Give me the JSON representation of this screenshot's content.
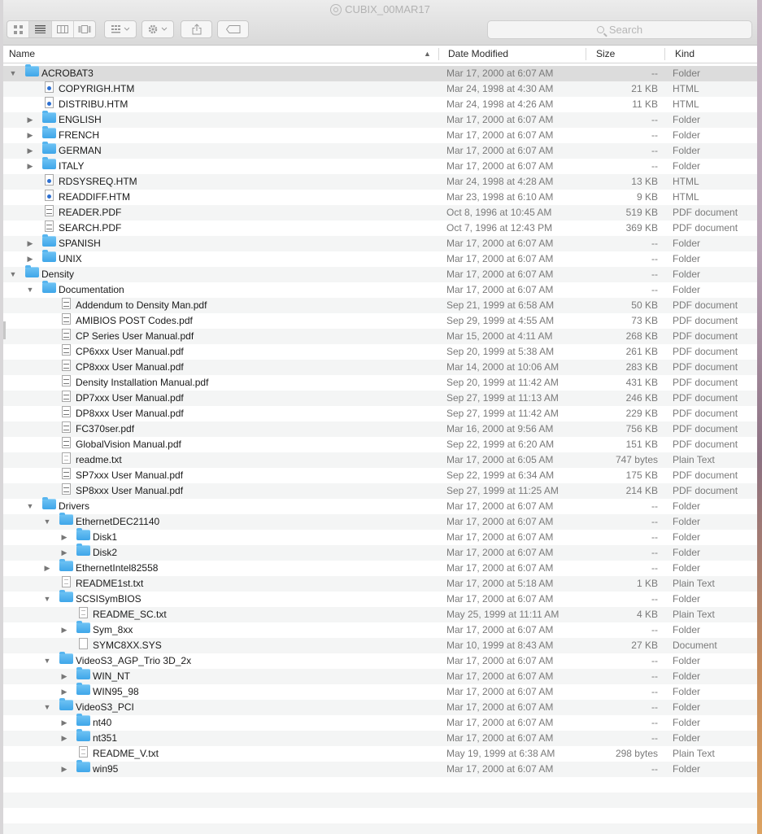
{
  "window": {
    "title": "CUBIX_00MAR17"
  },
  "toolbar": {
    "view_icons": [
      "icon-view-icon",
      "list-view-icon",
      "column-view-icon",
      "cover-flow-icon"
    ],
    "arrange_icon": "arrange-icon",
    "action_icon": "gear-icon",
    "share_icon": "share-icon",
    "tag_icon": "tag-icon"
  },
  "search": {
    "placeholder": "Search"
  },
  "columns": {
    "name": "Name",
    "date": "Date Modified",
    "size": "Size",
    "kind": "Kind"
  },
  "rows": [
    {
      "level": 0,
      "disc": "open",
      "icon": "folder",
      "name": "ACROBAT3",
      "date": "Mar 17, 2000 at 6:07 AM",
      "size": "--",
      "kind": "Folder",
      "selected": true
    },
    {
      "level": 1,
      "disc": "none",
      "icon": "html",
      "name": "COPYRIGH.HTM",
      "date": "Mar 24, 1998 at 4:30 AM",
      "size": "21 KB",
      "kind": "HTML"
    },
    {
      "level": 1,
      "disc": "none",
      "icon": "html",
      "name": "DISTRIBU.HTM",
      "date": "Mar 24, 1998 at 4:26 AM",
      "size": "11 KB",
      "kind": "HTML"
    },
    {
      "level": 1,
      "disc": "closed",
      "icon": "folder",
      "name": "ENGLISH",
      "date": "Mar 17, 2000 at 6:07 AM",
      "size": "--",
      "kind": "Folder"
    },
    {
      "level": 1,
      "disc": "closed",
      "icon": "folder",
      "name": "FRENCH",
      "date": "Mar 17, 2000 at 6:07 AM",
      "size": "--",
      "kind": "Folder"
    },
    {
      "level": 1,
      "disc": "closed",
      "icon": "folder",
      "name": "GERMAN",
      "date": "Mar 17, 2000 at 6:07 AM",
      "size": "--",
      "kind": "Folder"
    },
    {
      "level": 1,
      "disc": "closed",
      "icon": "folder",
      "name": "ITALY",
      "date": "Mar 17, 2000 at 6:07 AM",
      "size": "--",
      "kind": "Folder"
    },
    {
      "level": 1,
      "disc": "none",
      "icon": "html",
      "name": "RDSYSREQ.HTM",
      "date": "Mar 24, 1998 at 4:28 AM",
      "size": "13 KB",
      "kind": "HTML"
    },
    {
      "level": 1,
      "disc": "none",
      "icon": "html",
      "name": "READDIFF.HTM",
      "date": "Mar 23, 1998 at 6:10 AM",
      "size": "9 KB",
      "kind": "HTML"
    },
    {
      "level": 1,
      "disc": "none",
      "icon": "pdf",
      "name": "READER.PDF",
      "date": "Oct 8, 1996 at 10:45 AM",
      "size": "519 KB",
      "kind": "PDF document"
    },
    {
      "level": 1,
      "disc": "none",
      "icon": "pdf",
      "name": "SEARCH.PDF",
      "date": "Oct 7, 1996 at 12:43 PM",
      "size": "369 KB",
      "kind": "PDF document"
    },
    {
      "level": 1,
      "disc": "closed",
      "icon": "folder",
      "name": "SPANISH",
      "date": "Mar 17, 2000 at 6:07 AM",
      "size": "--",
      "kind": "Folder"
    },
    {
      "level": 1,
      "disc": "closed",
      "icon": "folder",
      "name": "UNIX",
      "date": "Mar 17, 2000 at 6:07 AM",
      "size": "--",
      "kind": "Folder"
    },
    {
      "level": 0,
      "disc": "open",
      "icon": "folder",
      "name": "Density",
      "date": "Mar 17, 2000 at 6:07 AM",
      "size": "--",
      "kind": "Folder"
    },
    {
      "level": 1,
      "disc": "open",
      "icon": "folder",
      "name": "Documentation",
      "date": "Mar 17, 2000 at 6:07 AM",
      "size": "--",
      "kind": "Folder"
    },
    {
      "level": 2,
      "disc": "none",
      "icon": "pdf",
      "name": "Addendum to Density Man.pdf",
      "date": "Sep 21, 1999 at 6:58 AM",
      "size": "50 KB",
      "kind": "PDF document"
    },
    {
      "level": 2,
      "disc": "none",
      "icon": "pdf",
      "name": "AMIBIOS POST Codes.pdf",
      "date": "Sep 29, 1999 at 4:55 AM",
      "size": "73 KB",
      "kind": "PDF document"
    },
    {
      "level": 2,
      "disc": "none",
      "icon": "pdf",
      "name": "CP Series User Manual.pdf",
      "date": "Mar 15, 2000 at 4:11 AM",
      "size": "268 KB",
      "kind": "PDF document"
    },
    {
      "level": 2,
      "disc": "none",
      "icon": "pdf",
      "name": "CP6xxx User Manual.pdf",
      "date": "Sep 20, 1999 at 5:38 AM",
      "size": "261 KB",
      "kind": "PDF document"
    },
    {
      "level": 2,
      "disc": "none",
      "icon": "pdf",
      "name": "CP8xxx User Manual.pdf",
      "date": "Mar 14, 2000 at 10:06 AM",
      "size": "283 KB",
      "kind": "PDF document"
    },
    {
      "level": 2,
      "disc": "none",
      "icon": "pdf",
      "name": "Density Installation Manual.pdf",
      "date": "Sep 20, 1999 at 11:42 AM",
      "size": "431 KB",
      "kind": "PDF document"
    },
    {
      "level": 2,
      "disc": "none",
      "icon": "pdf",
      "name": "DP7xxx User Manual.pdf",
      "date": "Sep 27, 1999 at 11:13 AM",
      "size": "246 KB",
      "kind": "PDF document"
    },
    {
      "level": 2,
      "disc": "none",
      "icon": "pdf",
      "name": "DP8xxx User Manual.pdf",
      "date": "Sep 27, 1999 at 11:42 AM",
      "size": "229 KB",
      "kind": "PDF document"
    },
    {
      "level": 2,
      "disc": "none",
      "icon": "pdf",
      "name": "FC370ser.pdf",
      "date": "Mar 16, 2000 at 9:56 AM",
      "size": "756 KB",
      "kind": "PDF document"
    },
    {
      "level": 2,
      "disc": "none",
      "icon": "pdf",
      "name": "GlobalVision Manual.pdf",
      "date": "Sep 22, 1999 at 6:20 AM",
      "size": "151 KB",
      "kind": "PDF document"
    },
    {
      "level": 2,
      "disc": "none",
      "icon": "text",
      "name": "readme.txt",
      "date": "Mar 17, 2000 at 6:05 AM",
      "size": "747 bytes",
      "kind": "Plain Text"
    },
    {
      "level": 2,
      "disc": "none",
      "icon": "pdf",
      "name": "SP7xxx User Manual.pdf",
      "date": "Sep 22, 1999 at 6:34 AM",
      "size": "175 KB",
      "kind": "PDF document"
    },
    {
      "level": 2,
      "disc": "none",
      "icon": "pdf",
      "name": "SP8xxx User Manual.pdf",
      "date": "Sep 27, 1999 at 11:25 AM",
      "size": "214 KB",
      "kind": "PDF document"
    },
    {
      "level": 1,
      "disc": "open",
      "icon": "folder",
      "name": "Drivers",
      "date": "Mar 17, 2000 at 6:07 AM",
      "size": "--",
      "kind": "Folder"
    },
    {
      "level": 2,
      "disc": "open",
      "icon": "folder",
      "name": "EthernetDEC21140",
      "date": "Mar 17, 2000 at 6:07 AM",
      "size": "--",
      "kind": "Folder"
    },
    {
      "level": 3,
      "disc": "closed",
      "icon": "folder",
      "name": "Disk1",
      "date": "Mar 17, 2000 at 6:07 AM",
      "size": "--",
      "kind": "Folder"
    },
    {
      "level": 3,
      "disc": "closed",
      "icon": "folder",
      "name": "Disk2",
      "date": "Mar 17, 2000 at 6:07 AM",
      "size": "--",
      "kind": "Folder"
    },
    {
      "level": 2,
      "disc": "closed",
      "icon": "folder",
      "name": "EthernetIntel82558",
      "date": "Mar 17, 2000 at 6:07 AM",
      "size": "--",
      "kind": "Folder"
    },
    {
      "level": 2,
      "disc": "none",
      "icon": "text",
      "name": "README1st.txt",
      "date": "Mar 17, 2000 at 5:18 AM",
      "size": "1 KB",
      "kind": "Plain Text"
    },
    {
      "level": 2,
      "disc": "open",
      "icon": "folder",
      "name": "SCSISymBIOS",
      "date": "Mar 17, 2000 at 6:07 AM",
      "size": "--",
      "kind": "Folder"
    },
    {
      "level": 3,
      "disc": "none",
      "icon": "text",
      "name": "README_SC.txt",
      "date": "May 25, 1999 at 11:11 AM",
      "size": "4 KB",
      "kind": "Plain Text"
    },
    {
      "level": 3,
      "disc": "closed",
      "icon": "folder",
      "name": "Sym_8xx",
      "date": "Mar 17, 2000 at 6:07 AM",
      "size": "--",
      "kind": "Folder"
    },
    {
      "level": 3,
      "disc": "none",
      "icon": "blank",
      "name": "SYMC8XX.SYS",
      "date": "Mar 10, 1999 at 8:43 AM",
      "size": "27 KB",
      "kind": "Document"
    },
    {
      "level": 2,
      "disc": "open",
      "icon": "folder",
      "name": "VideoS3_AGP_Trio 3D_2x",
      "date": "Mar 17, 2000 at 6:07 AM",
      "size": "--",
      "kind": "Folder"
    },
    {
      "level": 3,
      "disc": "closed",
      "icon": "folder",
      "name": "WIN_NT",
      "date": "Mar 17, 2000 at 6:07 AM",
      "size": "--",
      "kind": "Folder"
    },
    {
      "level": 3,
      "disc": "closed",
      "icon": "folder",
      "name": "WIN95_98",
      "date": "Mar 17, 2000 at 6:07 AM",
      "size": "--",
      "kind": "Folder"
    },
    {
      "level": 2,
      "disc": "open",
      "icon": "folder",
      "name": "VideoS3_PCI",
      "date": "Mar 17, 2000 at 6:07 AM",
      "size": "--",
      "kind": "Folder"
    },
    {
      "level": 3,
      "disc": "closed",
      "icon": "folder",
      "name": "nt40",
      "date": "Mar 17, 2000 at 6:07 AM",
      "size": "--",
      "kind": "Folder"
    },
    {
      "level": 3,
      "disc": "closed",
      "icon": "folder",
      "name": "nt351",
      "date": "Mar 17, 2000 at 6:07 AM",
      "size": "--",
      "kind": "Folder"
    },
    {
      "level": 3,
      "disc": "none",
      "icon": "text",
      "name": "README_V.txt",
      "date": "May 19, 1999 at 6:38 AM",
      "size": "298 bytes",
      "kind": "Plain Text"
    },
    {
      "level": 3,
      "disc": "closed",
      "icon": "folder",
      "name": "win95",
      "date": "Mar 17, 2000 at 6:07 AM",
      "size": "--",
      "kind": "Folder"
    }
  ],
  "empty_rows": 4
}
